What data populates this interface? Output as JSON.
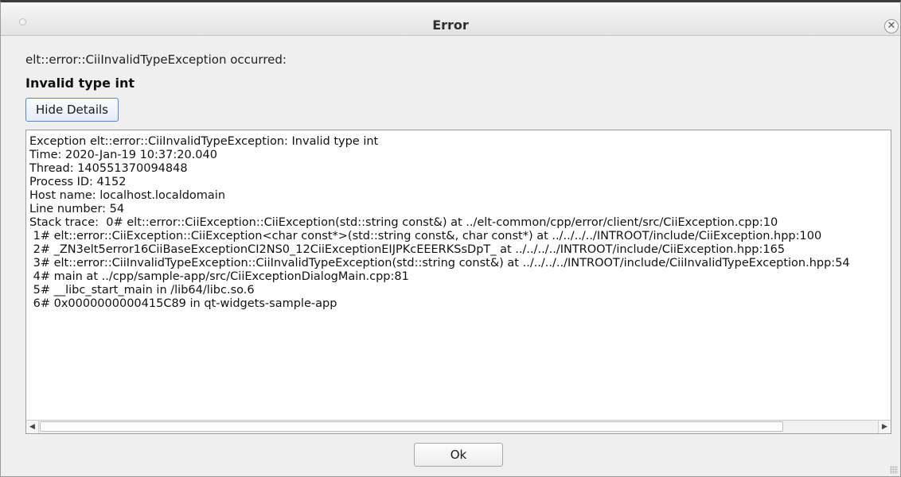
{
  "window": {
    "title": "Error",
    "close_symbol": "✕"
  },
  "message": {
    "summary": "elt::error::CiiInvalidTypeException occurred:",
    "headline": "Invalid type int"
  },
  "buttons": {
    "hide_details_label": "Hide Details",
    "ok_label": "Ok"
  },
  "details": {
    "text": "Exception elt::error::CiiInvalidTypeException: Invalid type int\nTime: 2020-Jan-19 10:37:20.040\nThread: 140551370094848\nProcess ID: 4152\nHost name: localhost.localdomain\nLine number: 54\nStack trace:  0# elt::error::CiiException::CiiException(std::string const&) at ../elt-common/cpp/error/client/src/CiiException.cpp:10\n 1# elt::error::CiiException::CiiException<char const*>(std::string const&, char const*) at ../../../../INTROOT/include/CiiException.hpp:100\n 2# _ZN3elt5error16CiiBaseExceptionCI2NS0_12CiiExceptionEIJPKcEEERKSsDpT_ at ../../../../INTROOT/include/CiiException.hpp:165\n 3# elt::error::CiiInvalidTypeException::CiiInvalidTypeException(std::string const&) at ../../../../INTROOT/include/CiiInvalidTypeException.hpp:54\n 4# main at ../cpp/sample-app/src/CiiExceptionDialogMain.cpp:81\n 5# __libc_start_main in /lib64/libc.so.6\n 6# 0x0000000000415C89 in qt-widgets-sample-app"
  },
  "scrollbar": {
    "left_arrow": "◀",
    "right_arrow": "▶"
  },
  "icons": [
    "window-menu-dot-icon",
    "close-icon",
    "resize-grip-icon"
  ]
}
